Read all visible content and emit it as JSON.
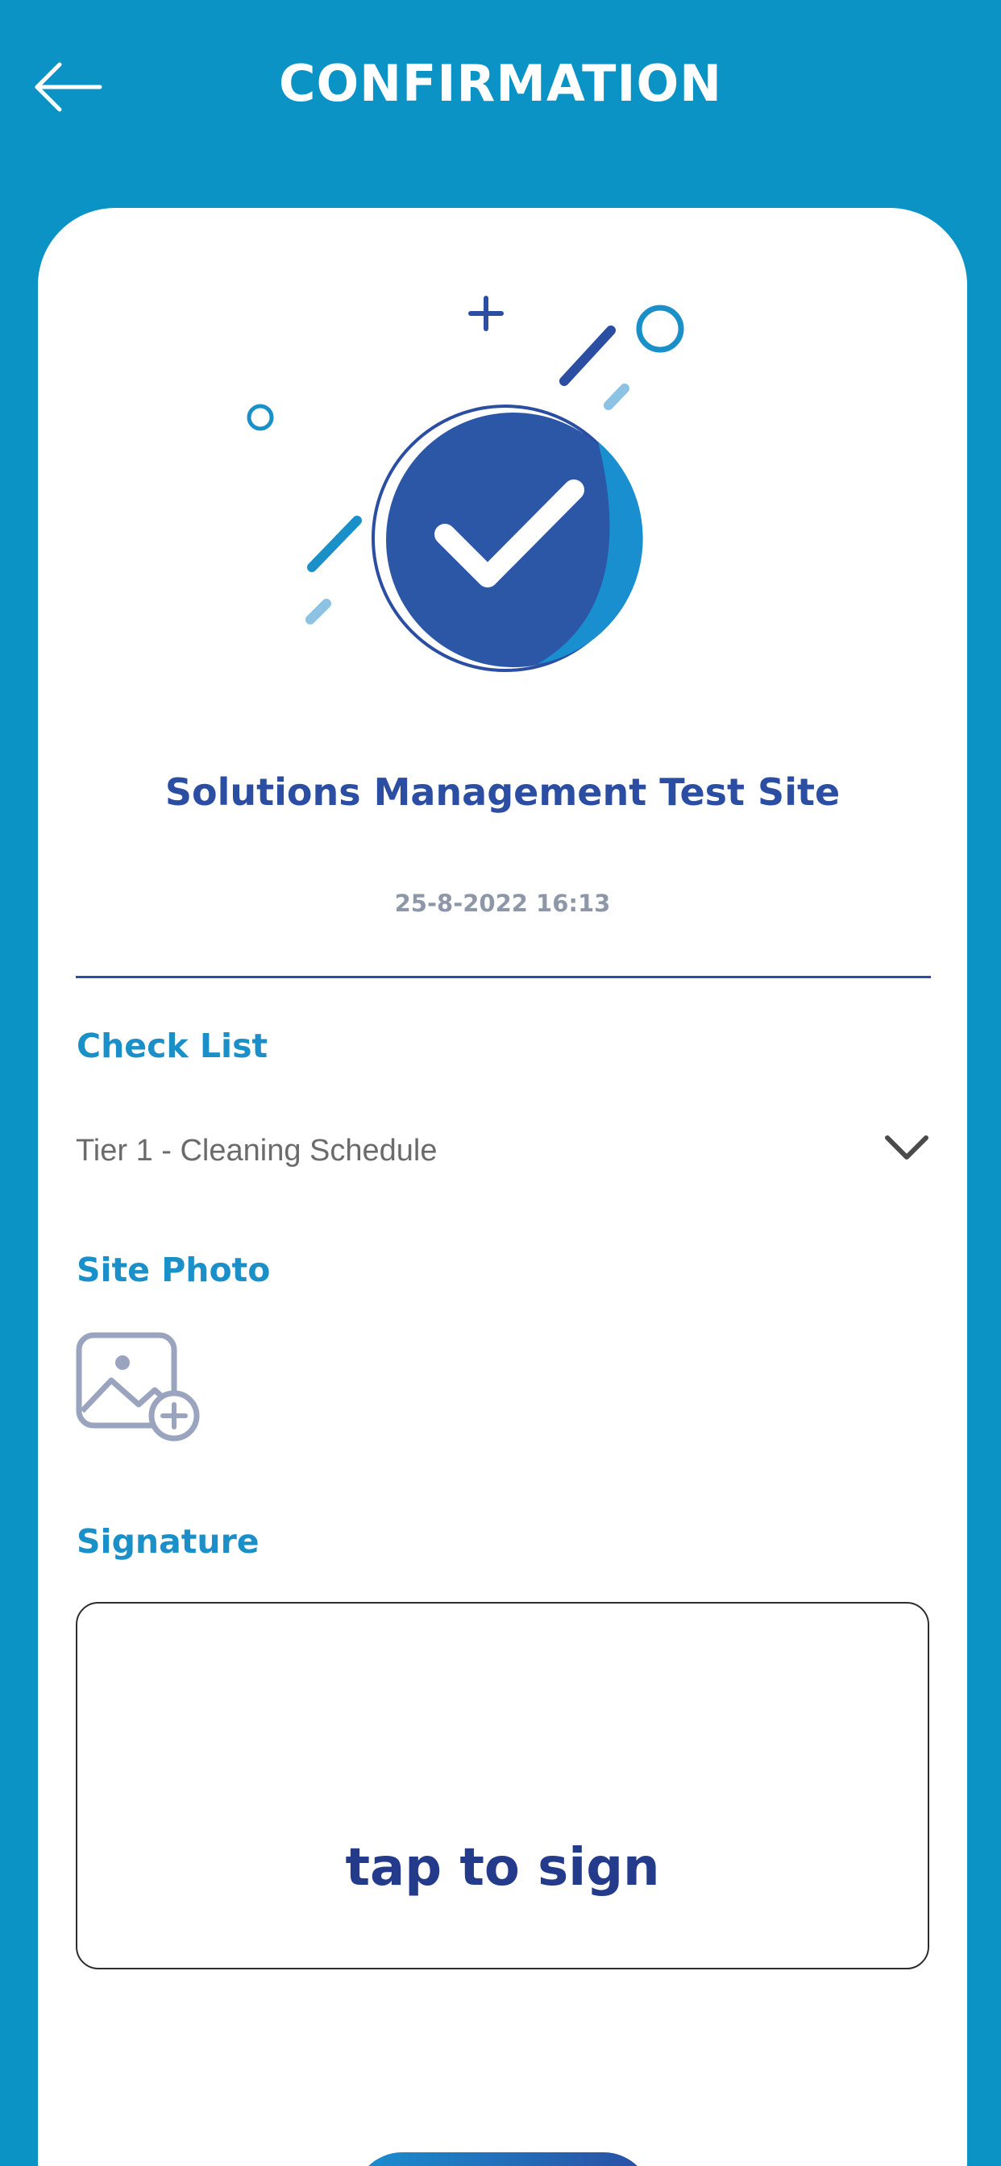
{
  "header": {
    "title": "CONFIRMATION",
    "back_icon": "arrow-left-icon"
  },
  "hero": {
    "icon": "check-circle-icon"
  },
  "site": {
    "name": "Solutions Management Test Site",
    "timestamp": "25-8-2022 16:13"
  },
  "checklist": {
    "label": "Check List",
    "value": "Tier 1 - Cleaning Schedule",
    "icon": "chevron-down-icon"
  },
  "site_photo": {
    "label": "Site Photo",
    "icon": "add-image-icon"
  },
  "signature": {
    "label": "Signature",
    "hint": "tap to sign"
  },
  "colors": {
    "header_bg": "#0a93c4",
    "accent_dark": "#2b4ea3",
    "accent_light": "#1a8fc8",
    "text_grey": "#6b6b6b"
  }
}
